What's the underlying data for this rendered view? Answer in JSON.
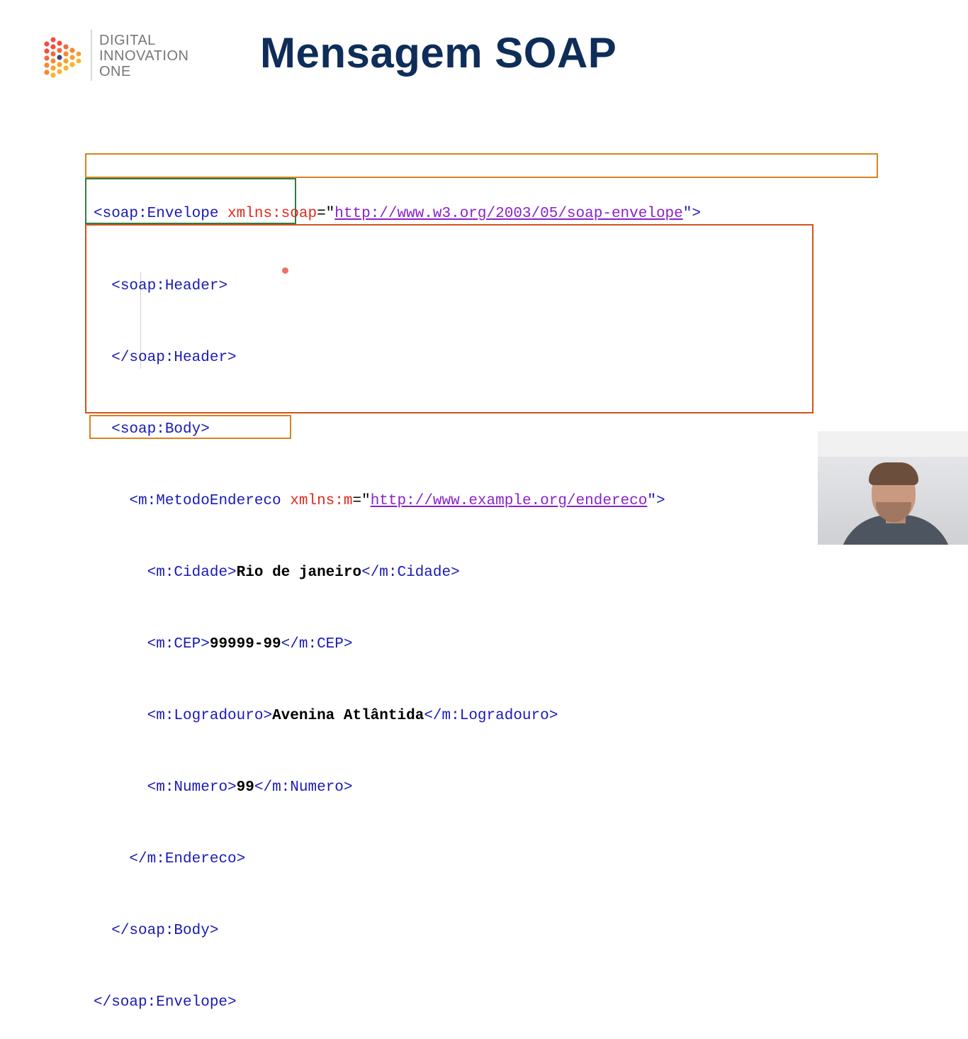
{
  "brand": {
    "line1": "DIGITAL",
    "line2": "INNOVATION",
    "line3": "ONE",
    "dot_colors": [
      "#f04e3e",
      "#f58a2e",
      "#f7b52c"
    ]
  },
  "slide": {
    "title": "Mensagem SOAP"
  },
  "frame_colors": {
    "envelope": "#d68420",
    "header": "#2f7d45",
    "body": "#d2531e"
  },
  "code": {
    "l1_open": "<soap:Envelope ",
    "l1_attr": "xmlns:soap",
    "l1_eq": "=\"",
    "l1_url": "http://www.w3.org/2003/05/soap-envelope",
    "l1_close": "\">",
    "l2": "<soap:Header>",
    "l3": "</soap:Header>",
    "l4": "<soap:Body>",
    "l5_open": "<m:MetodoEndereco ",
    "l5_attr": "xmlns:m",
    "l5_eq": "=\"",
    "l5_url": "http://www.example.org/endereco",
    "l5_close": "\">",
    "l6_open": "<m:Cidade>",
    "l6_text": "Rio de janeiro",
    "l6_close": "</m:Cidade>",
    "l7_open": "<m:CEP>",
    "l7_text": "99999-99",
    "l7_close": "</m:CEP>",
    "l8_open": "<m:Logradouro>",
    "l8_text": "Avenina Atlântida",
    "l8_close": "</m:Logradouro>",
    "l9_open": "<m:Numero>",
    "l9_text": "99",
    "l9_close": "</m:Numero>",
    "l10": "</m:Endereco>",
    "l11": "</soap:Body>",
    "l12": "</soap:Envelope>"
  }
}
